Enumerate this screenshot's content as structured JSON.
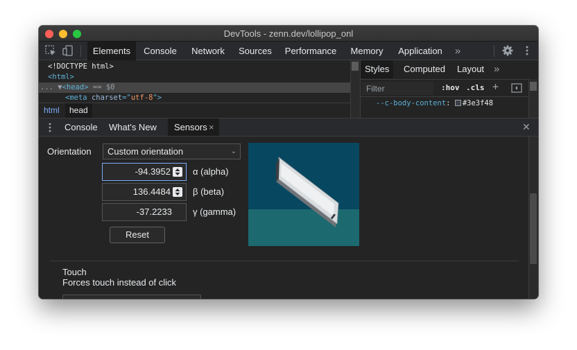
{
  "window": {
    "title": "DevTools - zenn.dev/lollipop_onl"
  },
  "main_tabs": [
    "Elements",
    "Console",
    "Network",
    "Sources",
    "Performance",
    "Memory",
    "Application"
  ],
  "more_tabs_glyph": "»",
  "elements_panel": {
    "lines": {
      "doctype": "<!DOCTYPE html>",
      "html_open": "<html>",
      "head_dots": "...",
      "head_arrow": "▼",
      "head_tag": "<head>",
      "head_suffix": " == $0",
      "meta_tag_open": "<meta ",
      "meta_attr": "charset",
      "meta_eq": "=\"",
      "meta_value": "utf-8",
      "meta_end": "\">"
    },
    "breadcrumbs": [
      "html",
      "head"
    ]
  },
  "styles_panel": {
    "tabs": [
      "Styles",
      "Computed",
      "Layout"
    ],
    "more_glyph": "»",
    "filter_placeholder": "Filter",
    "hov": ":hov",
    "cls": ".cls",
    "plus": "+",
    "css_property": "--c-body-content",
    "css_colon": ":",
    "css_value": "#3e3f48"
  },
  "drawer": {
    "tabs": [
      "Console",
      "What's New",
      "Sensors"
    ],
    "close_tab_glyph": "×",
    "close_drawer_glyph": "✕"
  },
  "sensors": {
    "orientation_label": "Orientation",
    "orientation_value": "Custom orientation",
    "alpha_value": "-94.3952",
    "alpha_label": "α (alpha)",
    "beta_value": "136.4484",
    "beta_label": "β (beta)",
    "gamma_value": "-37.2233",
    "gamma_label": "γ (gamma)",
    "reset_label": "Reset",
    "touch_title": "Touch",
    "touch_description": "Forces touch instead of click"
  },
  "colors": {
    "panel_bg": "#242424",
    "toolbar_bg": "#292a2d",
    "tag_blue": "#5db0d7",
    "link_blue": "#7cacf8",
    "attr_value_orange": "#f29766",
    "preview_sky": "#084760",
    "preview_floor": "#1c6a70"
  }
}
